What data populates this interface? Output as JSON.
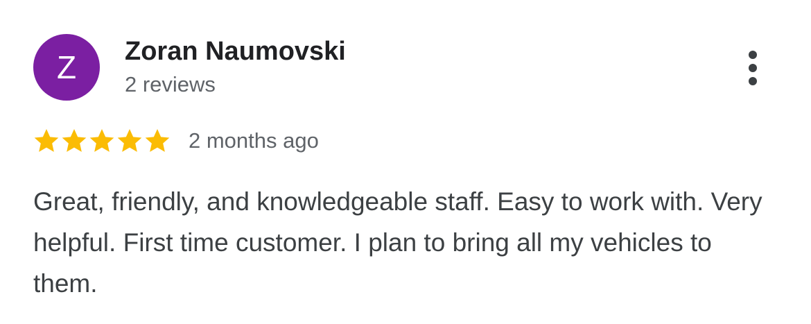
{
  "review": {
    "reviewer": {
      "initial": "Z",
      "name": "Zoran Naumovski",
      "review_count": "2 reviews",
      "avatar_color": "#7b1fa2"
    },
    "rating": {
      "stars": 5,
      "max_stars": 5,
      "star_color": "#fbbc04"
    },
    "date": "2 months ago",
    "text": "Great, friendly, and knowledgeable staff. Easy to work with. Very helpful. First time customer. I plan to bring all my vehicles to them.",
    "menu_icon": "more-vertical-icon"
  }
}
